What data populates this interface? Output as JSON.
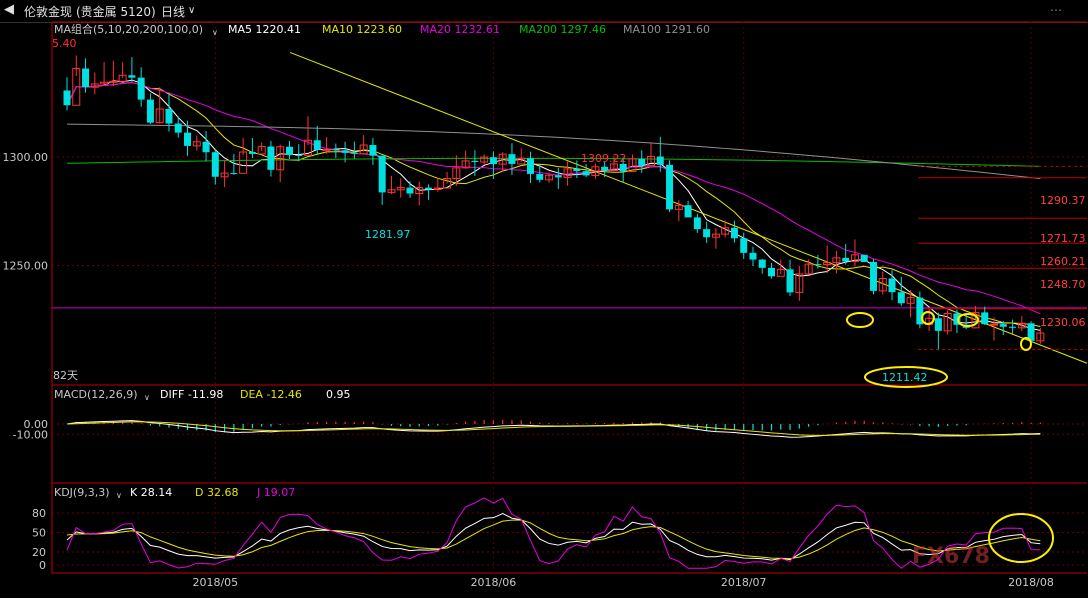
{
  "toolbar": {
    "back_icon": "back-arrow-icon",
    "title": "伦敦金现",
    "subtitle": "(贵金属  5120)",
    "period": "日线",
    "period_icon": "chevron-down-icon",
    "right_icon": "dotted-arrow-icon"
  },
  "ma_header": {
    "label": "MA组合(5,10,20,200,100,0)",
    "ma5": "MA5 1220.41",
    "ma10": "MA10 1223.60",
    "ma20": "MA20 1232.61",
    "ma200": "MA200 1297.46",
    "ma100": "MA100 1291.60"
  },
  "macd_header": {
    "label": "MACD(12,26,9)",
    "diff": "DIFF -11.98",
    "dea": "DEA -12.46",
    "macd": "0.95"
  },
  "kdj_header": {
    "label": "KDJ(9,3,3)",
    "k": "K 28.14",
    "d": "D 32.68",
    "j": "J 19.07"
  },
  "days_label": "82天",
  "top_price": "5.40",
  "price_labels": {
    "high": "1309.22",
    "low1": "1281.97",
    "low2": "1211.42"
  },
  "fib_levels": [
    "1290.37",
    "1271.73",
    "1260.21",
    "1248.70",
    "1230.06"
  ],
  "watermark": "FX678",
  "colors": {
    "up": "#ff3232",
    "down": "#00e0e0",
    "ma5": "#ffffff",
    "ma10": "#e6e600",
    "ma20": "#e600e6",
    "ma200": "#00c000",
    "ma100": "#909090",
    "trend": "#e6e600",
    "axis": "#c00000",
    "fib_label": "#ff4040"
  },
  "chart_data": [
    {
      "type": "candlestick",
      "title": "伦敦金现 日线",
      "x_ticks": [
        "2018/05",
        "2018/06",
        "2018/07",
        "2018/08"
      ],
      "y_ticks": [
        1300.0,
        1250.0
      ],
      "ylim": [
        1195,
        1362
      ],
      "candles": [
        [
          1330.5,
          1323.7,
          1336.6,
          1321.4
        ],
        [
          1323.7,
          1340.6,
          1346.6,
          1337.1
        ],
        [
          1340.6,
          1332.0,
          1345.3,
          1329.5
        ],
        [
          1332.0,
          1333.5,
          1338.8,
          1328.7
        ],
        [
          1333.5,
          1334.3,
          1343.6,
          1333.4
        ],
        [
          1334.3,
          1334.7,
          1344.2,
          1332.5
        ],
        [
          1334.7,
          1337.5,
          1343.5,
          1336.3
        ],
        [
          1337.5,
          1336.4,
          1345.8,
          1334.4
        ],
        [
          1336.4,
          1326.3,
          1341.2,
          1323.0
        ],
        [
          1326.3,
          1315.7,
          1329.1,
          1315.1
        ],
        [
          1315.7,
          1322.0,
          1332.0,
          1315.3
        ],
        [
          1322.0,
          1315.3,
          1329.5,
          1311.6
        ],
        [
          1315.3,
          1311.1,
          1318.5,
          1308.8
        ],
        [
          1311.1,
          1305.0,
          1316.6,
          1300.5
        ],
        [
          1305.0,
          1306.9,
          1309.8,
          1302.8
        ],
        [
          1306.9,
          1302.1,
          1311.8,
          1298.0
        ],
        [
          1302.1,
          1290.8,
          1303.2,
          1287.2
        ],
        [
          1290.8,
          1292.5,
          1298.6,
          1286.1
        ],
        [
          1292.5,
          1292.4,
          1301.3,
          1291.7
        ],
        [
          1292.4,
          1302.2,
          1308.7,
          1300.7
        ],
        [
          1302.2,
          1301.3,
          1308.6,
          1299.4
        ],
        [
          1301.3,
          1304.7,
          1306.6,
          1302.6
        ],
        [
          1304.7,
          1294.0,
          1307.3,
          1290.9
        ],
        [
          1294.0,
          1304.6,
          1305.6,
          1288.3
        ],
        [
          1304.6,
          1300.8,
          1307.3,
          1299.0
        ],
        [
          1300.8,
          1300.7,
          1305.8,
          1297.9
        ],
        [
          1300.7,
          1307.6,
          1318.6,
          1305.4
        ],
        [
          1307.6,
          1303.2,
          1314.2,
          1301.0
        ],
        [
          1303.2,
          1303.4,
          1309.0,
          1301.4
        ],
        [
          1303.4,
          1303.0,
          1306.1,
          1299.4
        ],
        [
          1303.0,
          1301.8,
          1306.9,
          1297.4
        ],
        [
          1301.8,
          1301.4,
          1307.0,
          1299.1
        ],
        [
          1301.4,
          1305.4,
          1310.0,
          1302.5
        ],
        [
          1305.4,
          1300.5,
          1308.6,
          1296.3
        ],
        [
          1300.5,
          1283.6,
          1300.6,
          1277.9
        ],
        [
          1283.6,
          1284.8,
          1291.2,
          1282.8
        ],
        [
          1284.8,
          1285.8,
          1290.0,
          1281.2
        ],
        [
          1285.8,
          1283.1,
          1288.7,
          1281.1
        ],
        [
          1283.1,
          1285.8,
          1288.6,
          1277.6
        ],
        [
          1285.8,
          1284.9,
          1287.3,
          1280.2
        ],
        [
          1284.9,
          1285.6,
          1290.4,
          1283.9
        ],
        [
          1285.6,
          1290.0,
          1293.0,
          1287.7
        ],
        [
          1290.0,
          1294.9,
          1300.7,
          1286.6
        ],
        [
          1294.9,
          1298.1,
          1302.8,
          1294.5
        ],
        [
          1298.1,
          1297.6,
          1303.0,
          1291.1
        ],
        [
          1297.6,
          1299.8,
          1301.1,
          1296.3
        ],
        [
          1299.8,
          1296.6,
          1302.5,
          1289.8
        ],
        [
          1296.6,
          1301.2,
          1302.1,
          1293.2
        ],
        [
          1301.2,
          1296.7,
          1306.2,
          1291.6
        ],
        [
          1296.7,
          1299.3,
          1303.8,
          1297.6
        ],
        [
          1299.3,
          1292.1,
          1302.3,
          1287.9
        ],
        [
          1292.1,
          1289.4,
          1296.3,
          1288.1
        ],
        [
          1289.4,
          1291.5,
          1292.8,
          1288.0
        ],
        [
          1291.5,
          1290.5,
          1294.9,
          1285.2
        ],
        [
          1290.5,
          1294.4,
          1297.8,
          1286.7
        ],
        [
          1294.4,
          1293.4,
          1298.3,
          1290.2
        ],
        [
          1293.4,
          1291.4,
          1296.6,
          1290.6
        ],
        [
          1291.4,
          1295.4,
          1296.9,
          1289.7
        ],
        [
          1295.4,
          1293.7,
          1297.8,
          1290.6
        ],
        [
          1293.7,
          1296.7,
          1300.0,
          1293.4
        ],
        [
          1296.7,
          1293.2,
          1299.7,
          1288.3
        ],
        [
          1293.2,
          1299.1,
          1301.0,
          1295.4
        ],
        [
          1299.1,
          1295.9,
          1303.0,
          1292.6
        ],
        [
          1295.9,
          1300.1,
          1306.7,
          1297.4
        ],
        [
          1300.1,
          1296.3,
          1309.2,
          1293.1
        ],
        [
          1296.3,
          1275.8,
          1298.4,
          1274.6
        ],
        [
          1275.8,
          1277.7,
          1280.0,
          1270.3
        ],
        [
          1277.7,
          1272.1,
          1279.7,
          1272.1
        ],
        [
          1272.1,
          1266.7,
          1273.8,
          1265.0
        ],
        [
          1266.7,
          1263.0,
          1270.1,
          1260.4
        ],
        [
          1263.0,
          1264.4,
          1267.2,
          1257.7
        ],
        [
          1264.4,
          1267.3,
          1270.7,
          1262.8
        ],
        [
          1267.3,
          1262.5,
          1270.6,
          1260.5
        ],
        [
          1262.5,
          1255.8,
          1265.0,
          1253.0
        ],
        [
          1255.8,
          1252.7,
          1258.6,
          1249.7
        ],
        [
          1252.7,
          1248.9,
          1253.0,
          1246.2
        ],
        [
          1248.9,
          1245.0,
          1251.2,
          1244.0
        ],
        [
          1245.0,
          1248.2,
          1252.7,
          1246.0
        ],
        [
          1248.2,
          1237.6,
          1252.6,
          1236.0
        ],
        [
          1237.6,
          1246.1,
          1249.8,
          1233.7
        ],
        [
          1246.1,
          1250.6,
          1252.8,
          1246.1
        ],
        [
          1250.6,
          1250.4,
          1254.8,
          1248.6
        ],
        [
          1250.4,
          1251.4,
          1259.2,
          1246.5
        ],
        [
          1251.4,
          1253.5,
          1256.7,
          1246.3
        ],
        [
          1253.5,
          1251.8,
          1259.8,
          1250.4
        ],
        [
          1251.8,
          1254.9,
          1262.0,
          1249.6
        ],
        [
          1254.9,
          1251.6,
          1254.2,
          1251.6
        ],
        [
          1251.6,
          1238.3,
          1253.0,
          1236.7
        ],
        [
          1238.3,
          1244.0,
          1247.2,
          1236.6
        ],
        [
          1244.0,
          1237.7,
          1248.0,
          1234.1
        ],
        [
          1237.7,
          1232.6,
          1244.8,
          1231.4
        ],
        [
          1232.6,
          1235.2,
          1238.6,
          1226.2
        ],
        [
          1235.2,
          1222.9,
          1238.0,
          1221.1
        ],
        [
          1222.9,
          1225.7,
          1229.9,
          1219.8
        ],
        [
          1225.7,
          1219.9,
          1228.3,
          1211.4
        ],
        [
          1219.9,
          1227.9,
          1229.4,
          1218.2
        ],
        [
          1227.9,
          1222.7,
          1229.7,
          1218.9
        ],
        [
          1222.7,
          1221.3,
          1227.4,
          1220.7
        ],
        [
          1221.3,
          1228.4,
          1231.4,
          1225.3
        ],
        [
          1228.4,
          1223.0,
          1231.1,
          1222.6
        ],
        [
          1223.0,
          1223.0,
          1226.1,
          1215.5
        ],
        [
          1223.0,
          1221.8,
          1224.5,
          1218.0
        ],
        [
          1221.8,
          1221.3,
          1225.1,
          1218.7
        ],
        [
          1221.3,
          1223.4,
          1226.7,
          1219.8
        ],
        [
          1223.4,
          1215.3,
          1224.4,
          1213.7
        ],
        [
          1215.3,
          1218.9,
          1221.2,
          1214.0
        ]
      ]
    }
  ]
}
